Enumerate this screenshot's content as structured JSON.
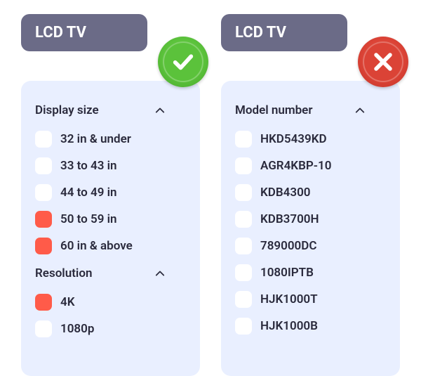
{
  "left": {
    "title": "LCD TV",
    "verdict": "good",
    "groups": [
      {
        "header": "Display size",
        "options": [
          {
            "label": "32 in & under",
            "checked": false
          },
          {
            "label": "33 to 43 in",
            "checked": false
          },
          {
            "label": "44 to 49 in",
            "checked": false
          },
          {
            "label": "50 to 59 in",
            "checked": true
          },
          {
            "label": "60 in & above",
            "checked": true
          }
        ]
      },
      {
        "header": "Resolution",
        "options": [
          {
            "label": "4K",
            "checked": true
          },
          {
            "label": "1080p",
            "checked": false
          }
        ]
      }
    ]
  },
  "right": {
    "title": "LCD TV",
    "verdict": "bad",
    "groups": [
      {
        "header": "Model number",
        "options": [
          {
            "label": "HKD5439KD",
            "checked": false
          },
          {
            "label": "AGR4KBP-10",
            "checked": false
          },
          {
            "label": "KDB4300",
            "checked": false
          },
          {
            "label": "KDB3700H",
            "checked": false
          },
          {
            "label": "789000DC",
            "checked": false
          },
          {
            "label": "1080IPTB",
            "checked": false
          },
          {
            "label": "HJK1000T",
            "checked": false
          },
          {
            "label": "HJK1000B",
            "checked": false
          }
        ]
      }
    ]
  }
}
